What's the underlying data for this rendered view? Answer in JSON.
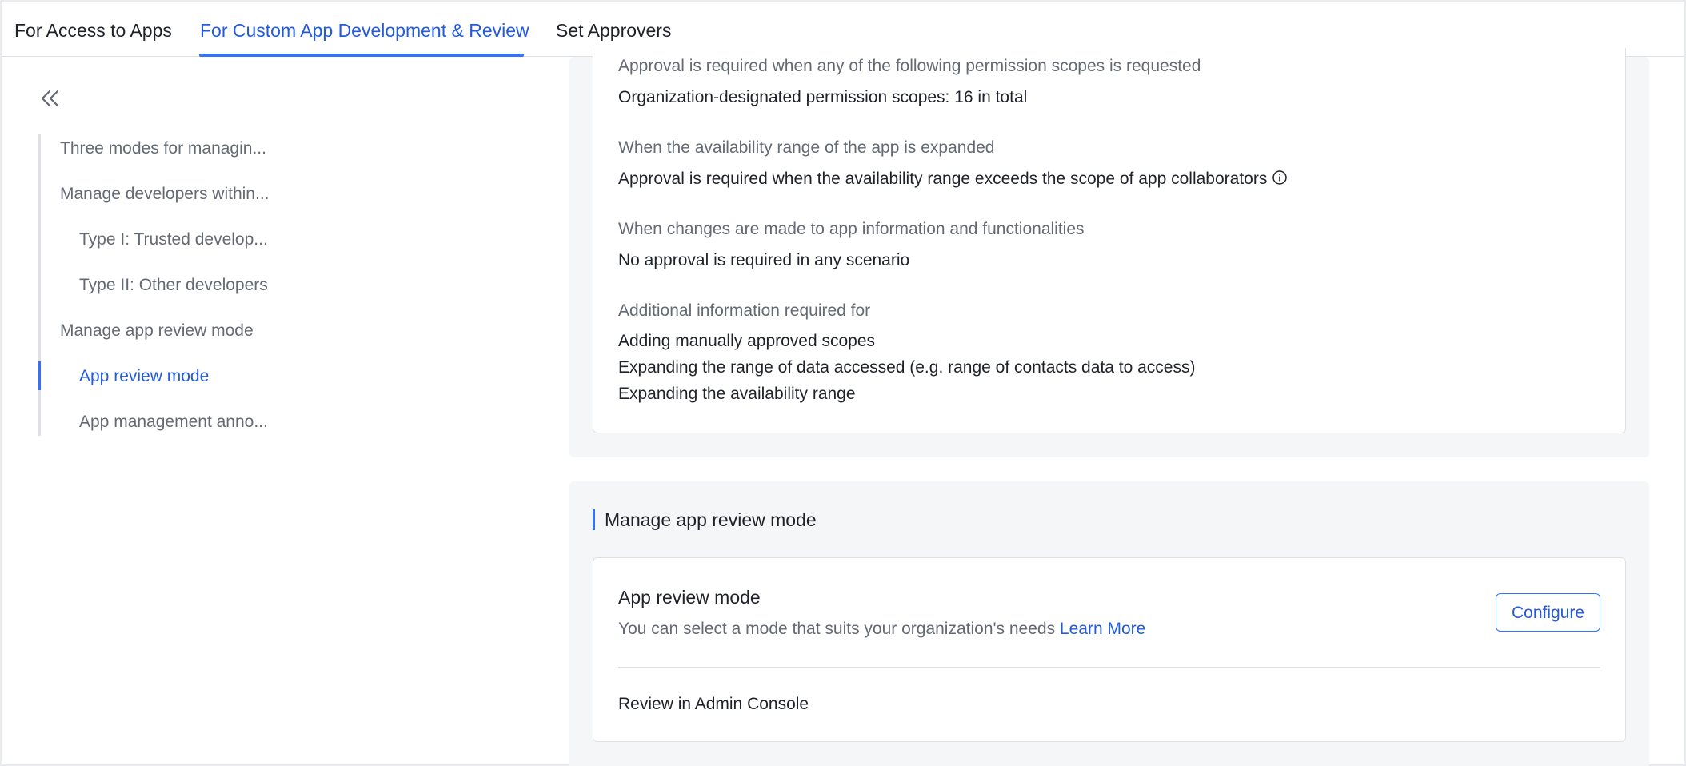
{
  "tabs": [
    {
      "label": "For Access to Apps"
    },
    {
      "label": "For Custom App Development & Review"
    },
    {
      "label": "Set Approvers"
    }
  ],
  "sidebar": {
    "items": [
      {
        "label": "Three modes for managin..."
      },
      {
        "label": "Manage developers within..."
      },
      {
        "label": "Type I: Trusted develop..."
      },
      {
        "label": "Type II: Other developers"
      },
      {
        "label": "Manage app review mode"
      },
      {
        "label": "App review mode"
      },
      {
        "label": "App management anno..."
      }
    ]
  },
  "scopes_card": {
    "permission_label": "Approval is required when any of the following permission scopes is requested",
    "permission_value": "Organization-designated permission scopes: 16 in total",
    "availability_label": "When the availability range of the app is expanded",
    "availability_value": "Approval is required when the availability range exceeds the scope of app collaborators",
    "changes_label": "When changes are made to app information and functionalities",
    "changes_value": "No approval is required in any scenario",
    "additional_label": "Additional information required for",
    "additional_items": [
      "Adding manually approved scopes",
      "Expanding the range of data accessed (e.g. range of contacts data to access)",
      "Expanding the availability range"
    ]
  },
  "review_section": {
    "title": "Manage app review mode",
    "card_title": "App review mode",
    "description": "You can select a mode that suits your organization's needs",
    "learn_more": "Learn More",
    "configure_label": "Configure",
    "mode_value": "Review in Admin Console"
  },
  "colors": {
    "accent": "#3370ff",
    "link": "#245bdb",
    "panel_bg": "#f5f6f7"
  }
}
